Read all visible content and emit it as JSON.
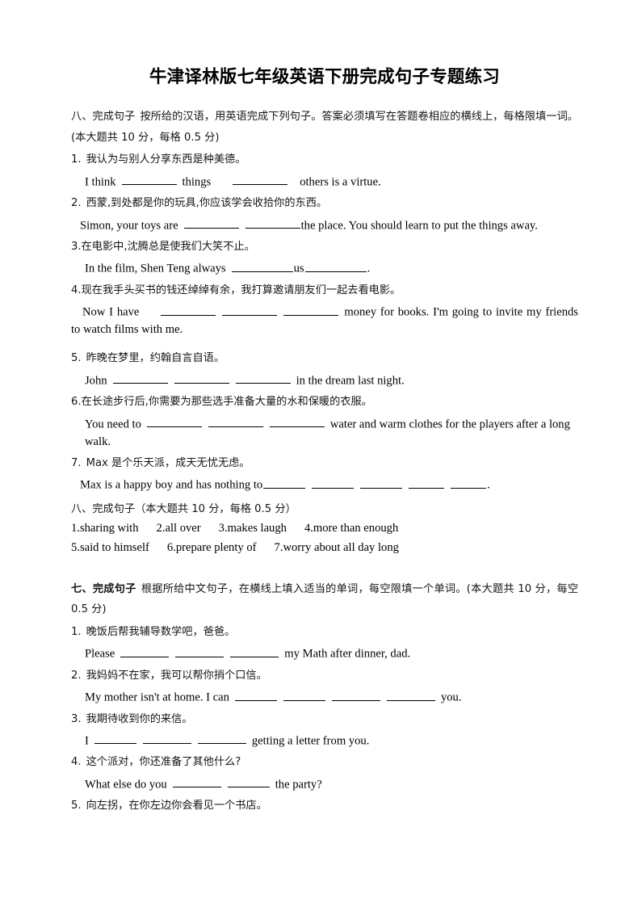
{
  "document": {
    "title": "牛津译林版七年级英语下册完成句子专题练习"
  },
  "section_eight": {
    "heading_prefix": "八、完成句子",
    "heading_body": "按所给的汉语，用英语完成下列句子。答案必须填写在答题卷相应的横线上，每格限填一词。(本大题共 10 分，每格 0.5 分)",
    "questions": [
      {
        "number": "1.",
        "zh": "我认为与别人分享东西是种美德。",
        "en_before": "I think",
        "en_mid": "things",
        "en_after": "others is a virtue."
      },
      {
        "number": "2.",
        "zh": "西蒙,到处都是你的玩具,你应该学会收拾你的东西。",
        "en_before": "Simon, your toys are",
        "en_after": "the place. You should learn to put the things away."
      },
      {
        "number": "3.",
        "zh": "在电影中,沈腾总是使我们大笑不止。",
        "en_before": "In the film, Shen Teng always",
        "en_mid": "us",
        "en_after": "."
      },
      {
        "number": "4.",
        "zh": "现在我手头买书的钱还绰绰有余，我打算邀请朋友们一起去看电影。",
        "en_before": "Now I have",
        "en_after": "money for books. I'm going to invite my friends to watch films with me."
      },
      {
        "number": "5.",
        "zh": "昨晚在梦里，约翰自言自语。",
        "en_before": "John",
        "en_after": "in the dream last night."
      },
      {
        "number": "6.",
        "zh": "在长途步行后,你需要为那些选手准备大量的水和保暖的衣服。",
        "en_before": "You need to",
        "en_after": "water and warm clothes for the players after a long walk."
      },
      {
        "number": "7.",
        "zh": "Max 是个乐天派，成天无忧无虑。",
        "en_before": "Max is a happy boy and has nothing to",
        "en_after": "."
      }
    ]
  },
  "answer_key": {
    "heading": "八、完成句子（本大题共 10 分，每格 0.5 分）",
    "row1": [
      "1.sharing with",
      "2.all over",
      "3.makes laugh",
      "4.more than enough"
    ],
    "row2": [
      "5.said to himself",
      "6.prepare plenty of",
      "7.worry about all day long"
    ]
  },
  "section_seven": {
    "heading_prefix": "七、完成句子",
    "heading_body": "根据所给中文句子，在横线上填入适当的单词，每空限填一个单词。(本大题共 10 分，每空 0.5 分)",
    "questions": [
      {
        "number": "1.",
        "zh": "晚饭后帮我辅导数学吧，爸爸。",
        "en_before": "Please",
        "en_after": "my Math after dinner, dad."
      },
      {
        "number": "2.",
        "zh": "我妈妈不在家，我可以帮你捎个口信。",
        "en_before": "My mother isn't at home. I can",
        "en_after": "you."
      },
      {
        "number": "3.",
        "zh": "我期待收到你的来信。",
        "en_before": "I",
        "en_after": "getting a letter from you."
      },
      {
        "number": "4.",
        "zh": "这个派对，你还准备了其他什么?",
        "en_before": "What else do you",
        "en_after": "the party?"
      },
      {
        "number": "5.",
        "zh": "向左拐，在你左边你会看见一个书店。",
        "en_before": "",
        "en_after": ""
      }
    ]
  }
}
